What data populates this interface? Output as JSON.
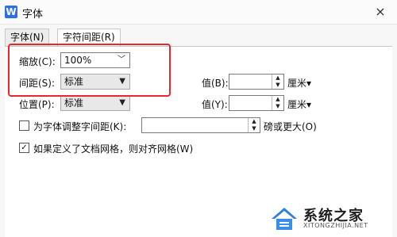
{
  "window": {
    "title": "字体",
    "app_icon_text": "W",
    "close_icon": "×"
  },
  "tabs": [
    {
      "label": "字体(N)",
      "active": false
    },
    {
      "label": "字符间距(R)",
      "active": true
    }
  ],
  "scale": {
    "label": "缩放(C):",
    "value": "100%"
  },
  "spacing": {
    "label": "间距(S):",
    "value": "标准",
    "amount_label": "值(B):",
    "amount_value": "",
    "unit": "厘米▾"
  },
  "position": {
    "label": "位置(P):",
    "value": "标准",
    "amount_label": "值(Y):",
    "amount_value": "",
    "unit": "厘米▾"
  },
  "kerning": {
    "label": "为字体调整字间距(K):",
    "checked": false,
    "value": "",
    "suffix": "磅或更大(O)"
  },
  "grid_snap": {
    "label": "如果定义了文档网格，则对齐网格(W)",
    "checked": true
  },
  "watermark": {
    "brand": "系统之家",
    "url": "XITONGZHIJIA.NET"
  }
}
